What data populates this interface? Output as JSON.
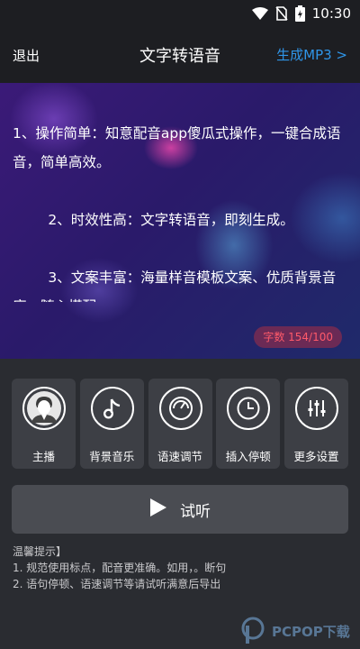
{
  "status": {
    "time": "10:30"
  },
  "header": {
    "back_label": "退出",
    "title": "文字转语音",
    "export_label": "生成MP3 >"
  },
  "editor": {
    "text": "1、操作简单：知意配音app傻瓜式操作，一键合成语音，简单高效。\n\n        2、时效性高：文字转语音，即刻生成。\n\n        3、文案丰富：海量样音模板文案、优质背景音库，随心搭配",
    "count_label": "字数 154/100",
    "count_color": "#ff5a6a"
  },
  "tools": [
    {
      "icon": "anchor-person-icon",
      "label": "主播"
    },
    {
      "icon": "music-note-icon",
      "label": "背景音乐"
    },
    {
      "icon": "speed-dial-icon",
      "label": "语速调节"
    },
    {
      "icon": "clock-icon",
      "label": "插入停顿"
    },
    {
      "icon": "sliders-icon",
      "label": "更多设置"
    }
  ],
  "listen_button": {
    "icon": "play-icon",
    "label": "试听"
  },
  "tips": {
    "title": "温馨提示】",
    "lines": [
      "1. 规范使用标点，配音更准确。如用，。断句",
      "2. 语句停顿、语速调节等请试听满意后导出"
    ]
  },
  "watermark": {
    "text": "PCPOP下载"
  },
  "colors": {
    "accent": "#2f95e8",
    "panel": "#3d3f45",
    "background": "#2a2c31"
  }
}
